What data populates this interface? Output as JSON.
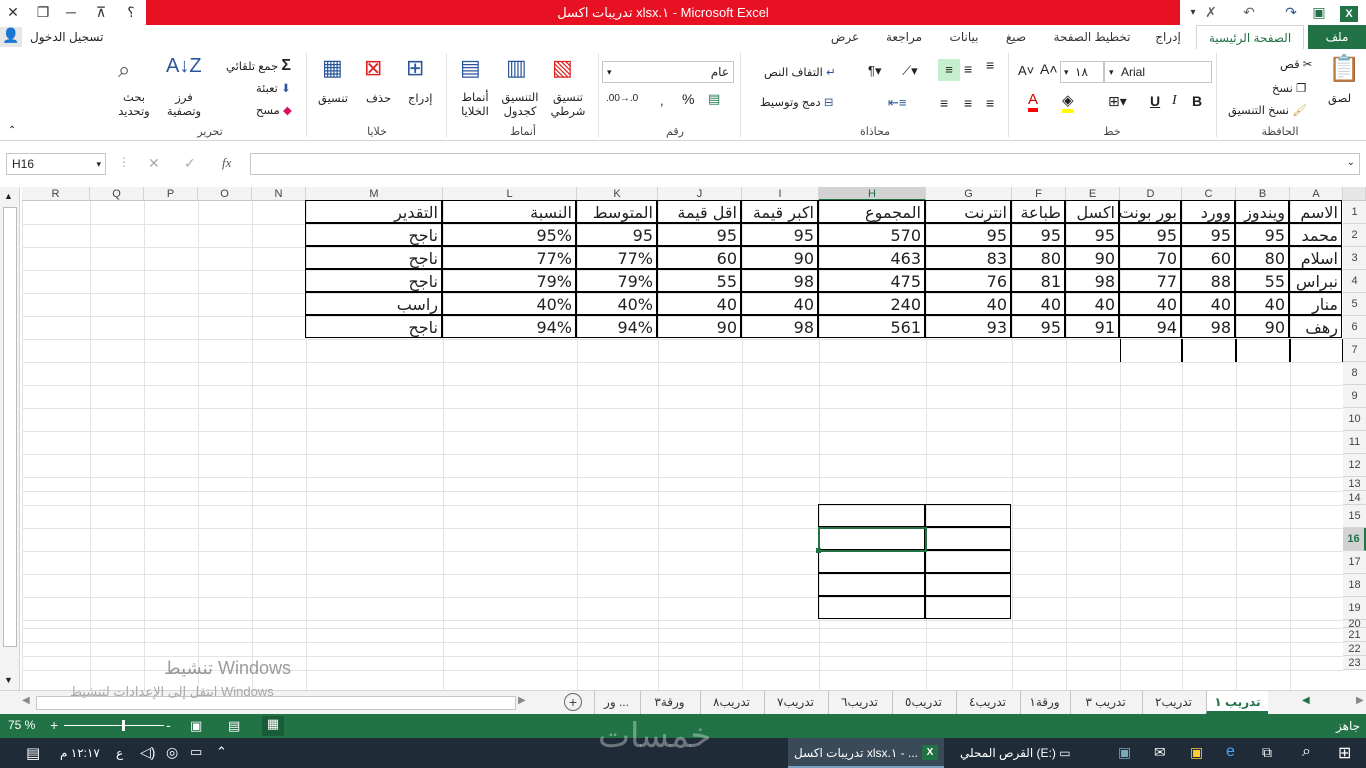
{
  "titlebar": {
    "title": "تدريبات اكسل xlsx.١ - Microsoft Excel",
    "help": "؟"
  },
  "menu": {
    "file": "ملف",
    "tabs": [
      "الصفحة الرئيسية",
      "إدراج",
      "تخطيط الصفحة",
      "صيغ",
      "بيانات",
      "مراجعة",
      "عرض"
    ],
    "signin": "تسجيل الدخول"
  },
  "ribbon": {
    "clipboard": {
      "label": "الحافظة",
      "paste": "لصق",
      "cut": "قص",
      "copy": "نسخ",
      "format_painter": "نسخ التنسيق"
    },
    "font": {
      "label": "خط",
      "name": "Arial",
      "size": "١٨",
      "bold": "B",
      "italic": "I",
      "underline": "U"
    },
    "alignment": {
      "label": "محاذاة",
      "wrap": "التفاف النص",
      "merge": "دمج وتوسيط"
    },
    "number": {
      "label": "رقم",
      "format": "عام"
    },
    "styles": {
      "label": "أنماط",
      "cond": "تنسيق شرطي",
      "table": "التنسيق كجدول",
      "cell": "أنماط الخلايا"
    },
    "cells": {
      "label": "خلايا",
      "insert": "إدراج",
      "delete": "حذف",
      "format": "تنسيق"
    },
    "editing": {
      "label": "تحرير",
      "autosum": "جمع تلقائي",
      "fill": "تعبئة",
      "clear": "مسح",
      "sort": "فرز وتصفية",
      "find": "بحث وتحديد"
    }
  },
  "formula": {
    "namebox": "H16",
    "fx": "fx",
    "content": ""
  },
  "columns": [
    "A",
    "B",
    "C",
    "D",
    "E",
    "F",
    "G",
    "H",
    "I",
    "J",
    "K",
    "L",
    "M",
    "N",
    "O",
    "P",
    "Q",
    "R"
  ],
  "rows": [
    "1",
    "2",
    "3",
    "4",
    "5",
    "6",
    "7",
    "8",
    "9",
    "10",
    "11",
    "12",
    "13",
    "14",
    "15",
    "16",
    "17",
    "18",
    "19",
    "20",
    "21",
    "22",
    "23"
  ],
  "table": {
    "headers": [
      "الاسم",
      "ويندوز",
      "وورد",
      "بور بونت",
      "اكسل",
      "طباعة",
      "انترنت",
      "المجموع",
      "اكبر قيمة",
      "اقل قيمة",
      "المتوسط",
      "النسبة",
      "التقدير"
    ],
    "rows": [
      [
        "محمد",
        "95",
        "95",
        "95",
        "95",
        "95",
        "95",
        "570",
        "95",
        "95",
        "95",
        "95%",
        "ناجح"
      ],
      [
        "اسلام",
        "80",
        "60",
        "70",
        "90",
        "80",
        "83",
        "463",
        "90",
        "60",
        "77%",
        "77%",
        "ناجح"
      ],
      [
        "نبراس",
        "55",
        "88",
        "77",
        "98",
        "81",
        "76",
        "475",
        "98",
        "55",
        "79%",
        "79%",
        "ناجح"
      ],
      [
        "منار",
        "40",
        "40",
        "40",
        "40",
        "40",
        "40",
        "240",
        "40",
        "40",
        "40%",
        "40%",
        "راسب"
      ],
      [
        "رهف",
        "90",
        "98",
        "94",
        "91",
        "95",
        "93",
        "561",
        "98",
        "90",
        "94%",
        "94%",
        "ناجح"
      ]
    ]
  },
  "sheet_tabs": [
    "تدريب ١",
    "تدريب٢",
    "تدريب ٣",
    "ورقة١",
    "تدريب٤",
    "تدريب٥",
    "تدريب٦",
    "تدريب٧",
    "تدريب٨",
    "ورقة٣",
    "ور ..."
  ],
  "active_sheet": "تدريب ١",
  "status": {
    "ready": "جاهز",
    "zoom": "75 %"
  },
  "activation": {
    "line1": "تنشيط Windows",
    "line2": "انتقل إلى الإعدادات لتنشيط Windows"
  },
  "watermark": "خمسات",
  "taskbar": {
    "drive": "القرص المحلي (E:)",
    "app": "تدريبات اكسل xlsx.١ - ...",
    "time": "١٢:١٧ م",
    "lang": "ع"
  }
}
